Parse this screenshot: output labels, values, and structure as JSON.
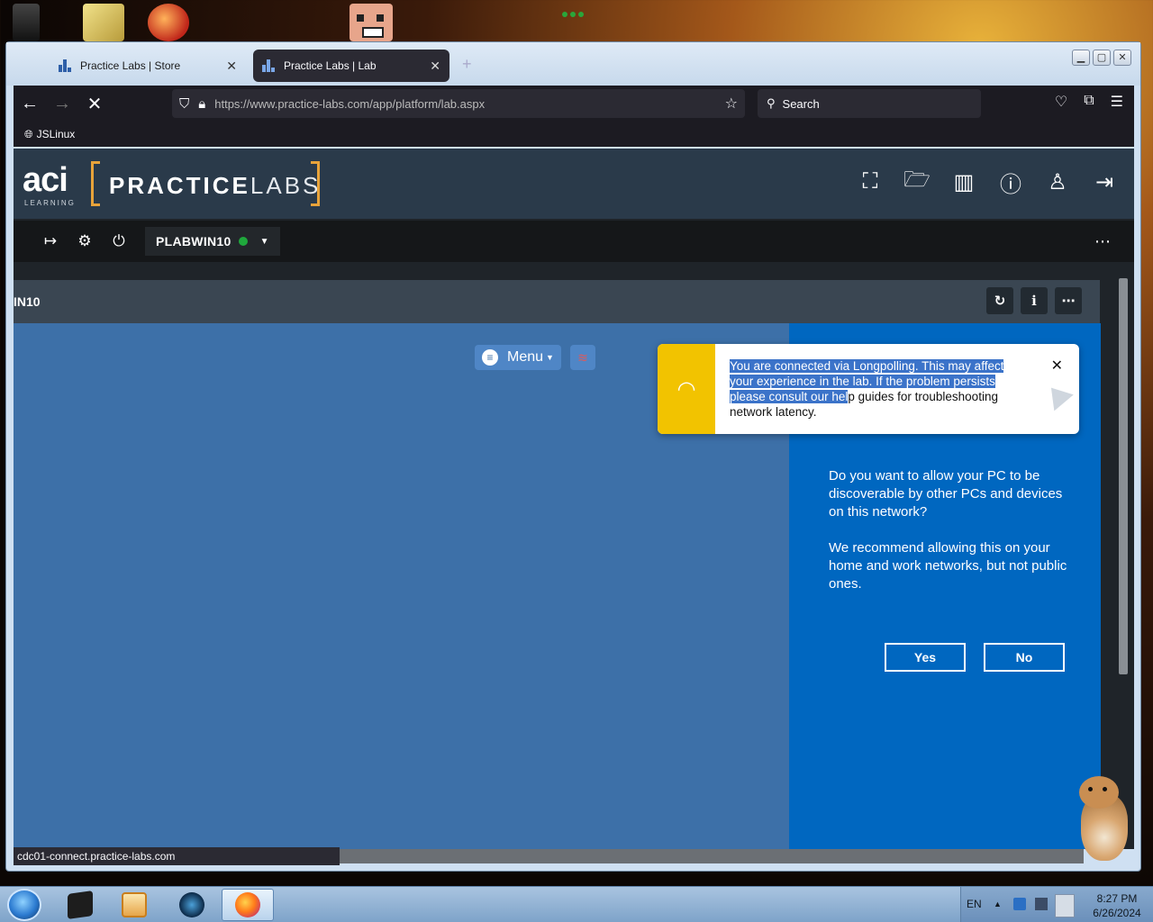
{
  "browser": {
    "tabs": [
      {
        "label": "Practice Labs | Store",
        "active": false
      },
      {
        "label": "Practice Labs | Lab",
        "active": true
      }
    ],
    "new_tab": "+",
    "url": "https://www.practice-labs.com/app/platform/lab.aspx",
    "search_placeholder": "Search",
    "bookmark": "JSLinux",
    "status_url": "cdc01-connect.practice-labs.com"
  },
  "practicelabs": {
    "brand_aci": "aci",
    "brand_learning": "LEARNING",
    "brand_practice": "PRACTICE",
    "brand_labs": "LABS",
    "machine_name": "PLABWIN10",
    "machine_status": "online",
    "vm_title": "IN10"
  },
  "guacamole": {
    "menu_label": "Menu"
  },
  "toast": {
    "message_selected": "You are connected via Longpolling. This may affect your experience in the lab. If the problem persists please consult our hel",
    "message_rest": "p guides for troubleshooting network latency.",
    "close": "✕"
  },
  "network_dialog": {
    "question": "Do you want to allow your PC to be discoverable by other PCs and devices on this network?",
    "recommendation": "We recommend allowing this on your home and work networks, but not public ones.",
    "yes_label": "Yes",
    "no_label": "No"
  },
  "taskbar": {
    "language": "EN",
    "time": "8:27 PM",
    "date": "6/26/2024"
  },
  "colors": {
    "accent_orange": "#e8a33a",
    "status_green": "#1fa83c",
    "toast_yellow": "#f2c300",
    "windows_blue": "#0067c0"
  }
}
